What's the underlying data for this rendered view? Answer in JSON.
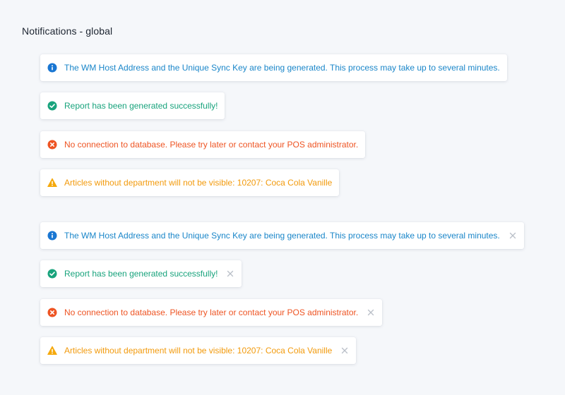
{
  "page": {
    "title": "Notifications - global"
  },
  "colors": {
    "info": "#1a86c9",
    "success": "#18a37c",
    "error": "#ee5423",
    "warning": "#f29a0c",
    "close": "#b9bfc8",
    "background": "#f5f7fa"
  },
  "notifications_static": [
    {
      "type": "info",
      "icon": "info-icon",
      "message": "The WM Host Address and the Unique Sync Key are being generated. This process may take up to several minutes."
    },
    {
      "type": "success",
      "icon": "check-circle-icon",
      "message": "Report has been generated successfully!"
    },
    {
      "type": "error",
      "icon": "error-circle-icon",
      "message": "No connection to database. Please try later or contact your POS administrator."
    },
    {
      "type": "warning",
      "icon": "warning-triangle-icon",
      "message": "Articles without department will not be visible: 10207: Coca Cola Vanille"
    }
  ],
  "notifications_dismissible": [
    {
      "type": "info",
      "icon": "info-icon",
      "message": "The WM Host Address and the Unique Sync Key are being generated. This process may take up to several minutes.",
      "close_icon": "close-icon"
    },
    {
      "type": "success",
      "icon": "check-circle-icon",
      "message": "Report has been generated successfully!",
      "close_icon": "close-icon"
    },
    {
      "type": "error",
      "icon": "error-circle-icon",
      "message": "No connection to database. Please try later or contact your POS administrator.",
      "close_icon": "close-icon"
    },
    {
      "type": "warning",
      "icon": "warning-triangle-icon",
      "message": "Articles without department will not be visible: 10207: Coca Cola Vanille",
      "close_icon": "close-icon"
    }
  ]
}
